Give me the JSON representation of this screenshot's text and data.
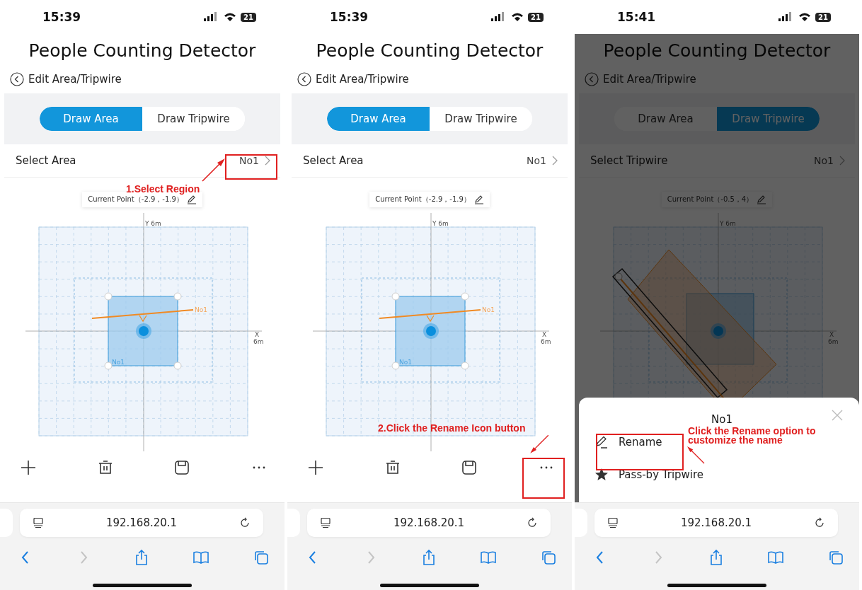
{
  "phones": [
    {
      "time": "15:39",
      "battery": "21",
      "title": "People Counting Detector",
      "back_label": "Edit Area/Tripwire",
      "tabs": [
        {
          "label": "Draw Area",
          "selected": true
        },
        {
          "label": "Draw Tripwire",
          "selected": false
        }
      ],
      "select_label": "Select Area",
      "select_value": "No1",
      "current_point": "Current Point（-2.9，-1.9）",
      "canvas": {
        "kind": "area",
        "y_label": "Y 6m",
        "x_label": "X",
        "x_unit": "6m",
        "line_label": "No1",
        "area_label": "No1"
      },
      "dimmed": false,
      "url": "192.168.20.1",
      "annotation": {
        "kind": "select",
        "text": "1.Select Region"
      }
    },
    {
      "time": "15:39",
      "battery": "21",
      "title": "People Counting Detector",
      "back_label": "Edit Area/Tripwire",
      "tabs": [
        {
          "label": "Draw Area",
          "selected": true
        },
        {
          "label": "Draw Tripwire",
          "selected": false
        }
      ],
      "select_label": "Select Area",
      "select_value": "No1",
      "current_point": "Current Point（-2.9，-1.9）",
      "canvas": {
        "kind": "area",
        "y_label": "Y 6m",
        "x_label": "X",
        "x_unit": "6m",
        "line_label": "No1",
        "area_label": "No1"
      },
      "dimmed": false,
      "url": "192.168.20.1",
      "annotation": {
        "kind": "more",
        "text": "2.Click the Rename Icon button"
      }
    },
    {
      "time": "15:41",
      "battery": "21",
      "title": "People Counting Detector",
      "back_label": "Edit Area/Tripwire",
      "tabs": [
        {
          "label": "Draw Area",
          "selected": false
        },
        {
          "label": "Draw Tripwire",
          "selected": true
        }
      ],
      "select_label": "Select Tripwire",
      "select_value": "No1",
      "current_point": "Current Point（-0.5，4）",
      "canvas": {
        "kind": "tripwire",
        "y_label": "Y 6m",
        "x_label": "X",
        "x_unit": "6m"
      },
      "dimmed": true,
      "url": "192.168.20.1",
      "sheet": {
        "title": "No1",
        "items": [
          {
            "kind": "rename",
            "label": "Rename"
          },
          {
            "kind": "star",
            "label": "Pass-by Tripwire"
          }
        ]
      },
      "annotation": {
        "kind": "rename",
        "text": "Click the Rename option to customize the name"
      }
    }
  ]
}
